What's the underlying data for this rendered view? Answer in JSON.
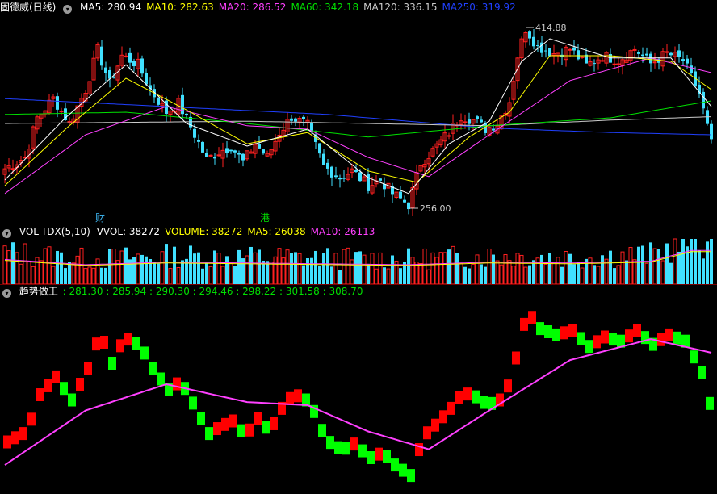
{
  "price_panel": {
    "stock_label": "固德威(日线)",
    "ma_labels": [
      {
        "text": "MA5: 280.94",
        "color": "#ffffff"
      },
      {
        "text": "MA10: 282.63",
        "color": "#ffff00"
      },
      {
        "text": "MA20: 286.52",
        "color": "#ff40ff"
      },
      {
        "text": "MA60: 342.18",
        "color": "#00e000"
      },
      {
        "text": "MA120: 336.15",
        "color": "#cccccc"
      },
      {
        "text": "MA250: 319.92",
        "color": "#2040ff"
      }
    ],
    "high_label": "414.88",
    "low_label": "256.00",
    "event_markers": [
      "财",
      "港"
    ]
  },
  "volume_panel": {
    "title": "VOL-TDX(5,10)",
    "labels": [
      {
        "text": "VVOL: 38272",
        "color": "#ffffff"
      },
      {
        "text": "VOLUME: 38272",
        "color": "#ffff00"
      },
      {
        "text": "MA5: 26038",
        "color": "#ffff00"
      },
      {
        "text": "MA10: 26113",
        "color": "#ff40ff"
      }
    ]
  },
  "indicator_panel": {
    "title": "趋势做王",
    "values_text": ": 281.30 : 285.94 : 290.30 : 294.46 : 298.22 : 301.58 : 308.70",
    "color": "#00e000"
  },
  "colors": {
    "up": "#ff2020",
    "down": "#40e0ff",
    "indicator_up": "#ff0000",
    "indicator_down": "#00ff00",
    "indicator_line": "#ff40ff",
    "ma5": "#ffffff",
    "ma10": "#ffff00",
    "ma20": "#ff40ff",
    "ma60": "#00e000",
    "ma120": "#cccccc",
    "ma250": "#2040ff"
  },
  "chart_data": [
    {
      "type": "candlestick",
      "name": "price",
      "ylim": [
        245,
        425
      ],
      "annotations": [
        {
          "text": "414.88",
          "value": 414.88
        },
        {
          "text": "256.00",
          "value": 256.0
        }
      ],
      "close_path": [
        [
          0,
          290
        ],
        [
          5,
          300
        ],
        [
          8,
          335
        ],
        [
          12,
          352
        ],
        [
          16,
          330
        ],
        [
          20,
          360
        ],
        [
          23,
          395
        ],
        [
          26,
          365
        ],
        [
          29,
          390
        ],
        [
          33,
          382
        ],
        [
          36,
          360
        ],
        [
          40,
          340
        ],
        [
          43,
          348
        ],
        [
          47,
          320
        ],
        [
          50,
          298
        ],
        [
          53,
          305
        ],
        [
          56,
          310
        ],
        [
          59,
          296
        ],
        [
          62,
          312
        ],
        [
          65,
          300
        ],
        [
          68,
          322
        ],
        [
          71,
          336
        ],
        [
          75,
          328
        ],
        [
          79,
          292
        ],
        [
          83,
          282
        ],
        [
          86,
          288
        ],
        [
          90,
          275
        ],
        [
          93,
          280
        ],
        [
          96,
          268
        ],
        [
          100,
          258
        ],
        [
          103,
          295
        ],
        [
          106,
          306
        ],
        [
          110,
          322
        ],
        [
          113,
          337
        ],
        [
          116,
          333
        ],
        [
          119,
          325
        ],
        [
          122,
          330
        ],
        [
          125,
          350
        ],
        [
          127,
          390
        ],
        [
          129,
          414
        ],
        [
          132,
          398
        ],
        [
          136,
          392
        ],
        [
          140,
          396
        ],
        [
          144,
          381
        ],
        [
          148,
          390
        ],
        [
          152,
          386
        ],
        [
          156,
          396
        ],
        [
          160,
          383
        ],
        [
          164,
          392
        ],
        [
          168,
          386
        ],
        [
          172,
          356
        ],
        [
          175,
          312
        ]
      ],
      "ma_paths": {
        "ma5": [
          [
            0,
            280
          ],
          [
            15,
            335
          ],
          [
            30,
            382
          ],
          [
            45,
            330
          ],
          [
            60,
            310
          ],
          [
            75,
            325
          ],
          [
            90,
            282
          ],
          [
            100,
            268
          ],
          [
            110,
            312
          ],
          [
            120,
            332
          ],
          [
            128,
            385
          ],
          [
            135,
            405
          ],
          [
            150,
            388
          ],
          [
            165,
            388
          ],
          [
            175,
            345
          ]
        ],
        "ma10": [
          [
            0,
            275
          ],
          [
            15,
            325
          ],
          [
            30,
            370
          ],
          [
            45,
            342
          ],
          [
            60,
            312
          ],
          [
            75,
            322
          ],
          [
            90,
            288
          ],
          [
            102,
            278
          ],
          [
            115,
            318
          ],
          [
            125,
            340
          ],
          [
            135,
            390
          ],
          [
            150,
            390
          ],
          [
            165,
            385
          ],
          [
            175,
            360
          ]
        ],
        "ma20": [
          [
            0,
            268
          ],
          [
            20,
            320
          ],
          [
            40,
            345
          ],
          [
            60,
            328
          ],
          [
            75,
            325
          ],
          [
            90,
            300
          ],
          [
            105,
            283
          ],
          [
            120,
            320
          ],
          [
            140,
            368
          ],
          [
            160,
            388
          ],
          [
            175,
            375
          ]
        ],
        "ma60": [
          [
            0,
            338
          ],
          [
            30,
            340
          ],
          [
            60,
            330
          ],
          [
            90,
            318
          ],
          [
            120,
            328
          ],
          [
            150,
            335
          ],
          [
            175,
            350
          ]
        ],
        "ma120": [
          [
            0,
            330
          ],
          [
            60,
            332
          ],
          [
            90,
            330
          ],
          [
            120,
            328
          ],
          [
            150,
            333
          ],
          [
            175,
            336
          ]
        ],
        "ma250": [
          [
            0,
            352
          ],
          [
            40,
            345
          ],
          [
            80,
            338
          ],
          [
            120,
            326
          ],
          [
            150,
            322
          ],
          [
            175,
            320
          ]
        ]
      }
    },
    {
      "type": "bar",
      "name": "volume",
      "labels": [
        "VVOL",
        "VOLUME",
        "MA5",
        "MA10"
      ],
      "values": [
        38272,
        38272,
        26038,
        26113
      ],
      "volume_path": [
        [
          0,
          28000
        ],
        [
          20,
          22000
        ],
        [
          40,
          25000
        ],
        [
          60,
          24000
        ],
        [
          80,
          23000
        ],
        [
          100,
          22000
        ],
        [
          120,
          25000
        ],
        [
          140,
          24000
        ],
        [
          160,
          26000
        ],
        [
          170,
          38272
        ],
        [
          175,
          38272
        ]
      ]
    },
    {
      "type": "step",
      "name": "趋势做王",
      "ylim": [
        245,
        425
      ],
      "values": [
        281.3,
        285.94,
        290.3,
        294.46,
        298.22,
        301.58,
        308.7
      ]
    }
  ]
}
